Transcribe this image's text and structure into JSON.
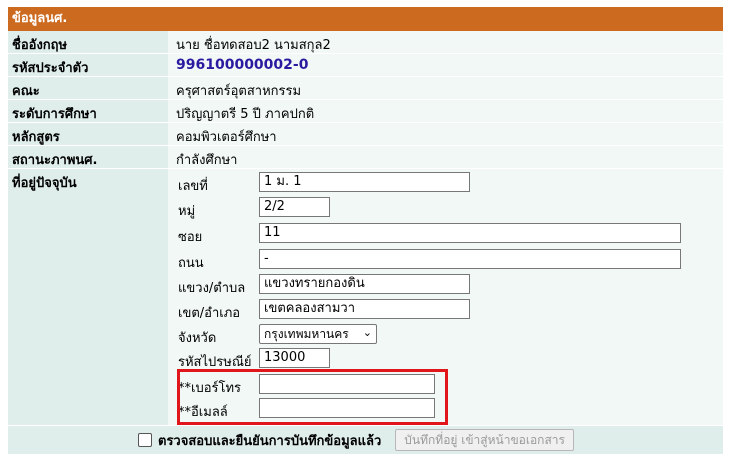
{
  "panel": {
    "title": "ข้อมูลนศ."
  },
  "fields": [
    {
      "label": "ชื่ออังกฤษ",
      "value": "นาย ชื่อทดสอบ2 นามสกุล2"
    },
    {
      "label": "รหัสประจำตัว",
      "value": "996100000002-0"
    },
    {
      "label": "คณะ",
      "value": "ครุศาสตร์อุตสาหกรรม"
    },
    {
      "label": "ระดับการศึกษา",
      "value": "ปริญญาตรี 5 ปี ภาคปกติ"
    },
    {
      "label": "หลักสูตร",
      "value": "คอมพิวเตอร์ศึกษา"
    },
    {
      "label": "สถานะภาพนศ.",
      "value": "กำลังศึกษา"
    }
  ],
  "address": {
    "label": "ที่อยู่ปัจจุบัน",
    "house_no": {
      "label": "เลขที่",
      "value": "1 ม. 1"
    },
    "moo": {
      "label": "หมู่",
      "value": "2/2"
    },
    "soi": {
      "label": "ซอย",
      "value": "11"
    },
    "road": {
      "label": "ถนน",
      "value": "-"
    },
    "subdistrict": {
      "label": "แขวง/ตำบล",
      "value": "แขวงทรายกองดิน"
    },
    "district": {
      "label": "เขต/อำเภอ",
      "value": "เขตคลองสามวา"
    },
    "province": {
      "label": "จังหวัด",
      "value": "กรุงเทพมหานคร"
    },
    "postcode": {
      "label": "รหัสไปรษณีย์",
      "value": "13000"
    },
    "phone": {
      "label": "**เบอร์โทร",
      "value": ""
    },
    "email": {
      "label": "**อีเมลล์",
      "value": ""
    }
  },
  "footer": {
    "confirm_label": "ตรวจสอบและยืนยันการบันทึกข้อมูลแล้ว",
    "save_button": "บันทึกที่อยู่ เข้าสู่หน้าขอเอกสาร"
  },
  "colors": {
    "header": "#cc6a1f",
    "highlight": "#e0161b"
  }
}
